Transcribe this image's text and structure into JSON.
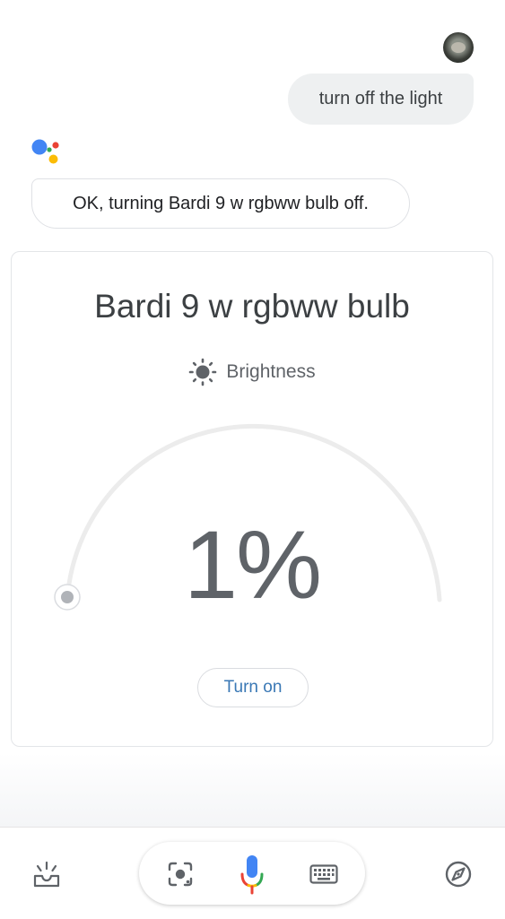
{
  "conversation": {
    "user_query": "turn off the light",
    "assistant_response": "OK, turning Bardi 9 w rgbww bulb off."
  },
  "device_card": {
    "device_name": "Bardi 9 w rgbww bulb",
    "control_icon": "brightness-icon",
    "control_label": "Brightness",
    "brightness_value": 1,
    "brightness_display": "1%",
    "action_button_label": "Turn on"
  },
  "bottom_bar": {
    "left_icon": "updates-inbox-icon",
    "pill_icons": [
      "lens-icon",
      "mic-icon",
      "keyboard-icon"
    ],
    "right_icon": "explore-compass-icon"
  },
  "colors": {
    "google_blue": "#4285F4",
    "google_red": "#EA4335",
    "google_yellow": "#FBBC05",
    "google_green": "#34A853",
    "button_text": "#3a78b5",
    "user_bubble": "#eef0f1"
  }
}
